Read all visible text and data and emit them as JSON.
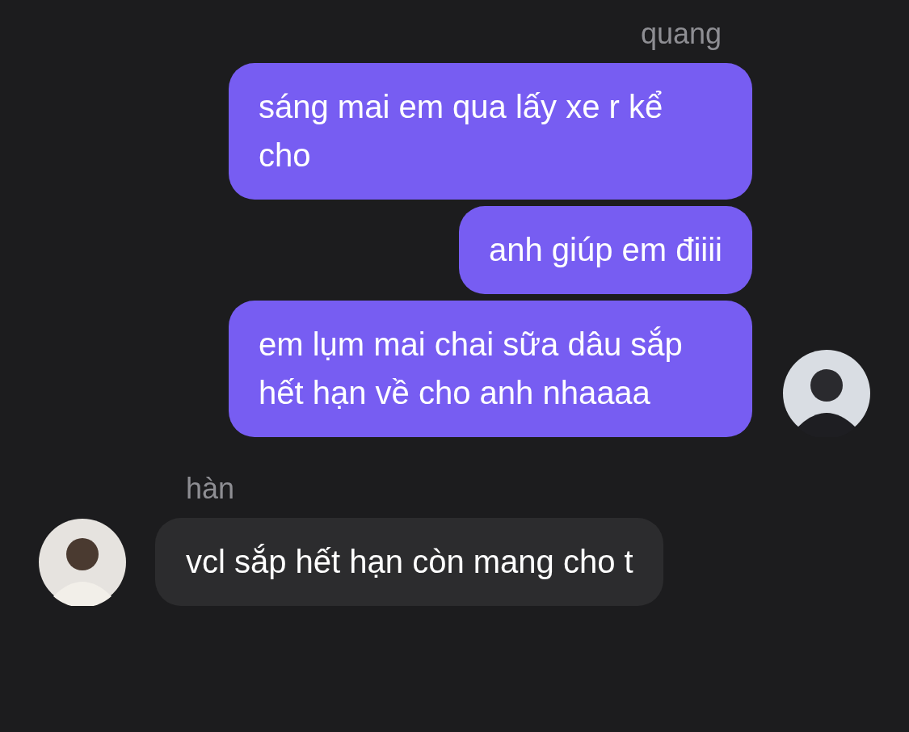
{
  "groups": [
    {
      "kind": "outgoing",
      "name": "quang",
      "messages": [
        "sáng mai em qua lấy xe r kể cho",
        "anh giúp em điiii",
        "em lụm mai chai sữa dâu sắp hết hạn về cho anh nhaaaa"
      ]
    },
    {
      "kind": "incoming",
      "name": "hàn",
      "messages": [
        "vcl sắp hết hạn còn mang cho t"
      ]
    }
  ]
}
